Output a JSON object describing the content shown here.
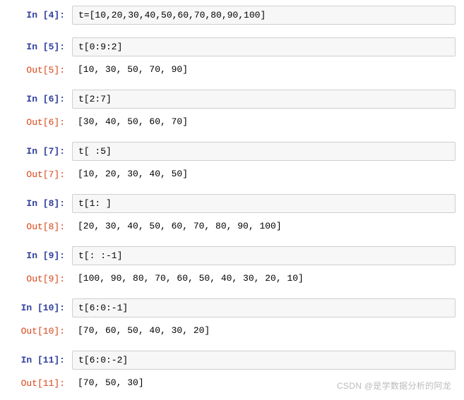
{
  "cells": [
    {
      "type": "in",
      "prompt": "In  [4]:",
      "content": "t=[10,20,30,40,50,60,70,80,90,100]"
    },
    {
      "type": "gap"
    },
    {
      "type": "in",
      "prompt": "In  [5]:",
      "content": "t[0:9:2]"
    },
    {
      "type": "out",
      "prompt": "Out[5]:",
      "content": "[10, 30, 50, 70, 90]"
    },
    {
      "type": "gap"
    },
    {
      "type": "in",
      "prompt": "In  [6]:",
      "content": "t[2:7]"
    },
    {
      "type": "out",
      "prompt": "Out[6]:",
      "content": "[30, 40, 50, 60, 70]"
    },
    {
      "type": "gap"
    },
    {
      "type": "in",
      "prompt": "In  [7]:",
      "content": "t[ :5]"
    },
    {
      "type": "out",
      "prompt": "Out[7]:",
      "content": "[10, 20, 30, 40, 50]"
    },
    {
      "type": "gap"
    },
    {
      "type": "in",
      "prompt": "In  [8]:",
      "content": "t[1: ]"
    },
    {
      "type": "out",
      "prompt": "Out[8]:",
      "content": "[20, 30, 40, 50, 60, 70, 80, 90, 100]"
    },
    {
      "type": "gap"
    },
    {
      "type": "in",
      "prompt": "In  [9]:",
      "content": "t[: :-1]"
    },
    {
      "type": "out",
      "prompt": "Out[9]:",
      "content": "[100, 90, 80, 70, 60, 50, 40, 30, 20, 10]"
    },
    {
      "type": "gap"
    },
    {
      "type": "in",
      "prompt": "In  [10]:",
      "content": "t[6:0:-1]"
    },
    {
      "type": "out",
      "prompt": "Out[10]:",
      "content": "[70, 60, 50, 40, 30, 20]"
    },
    {
      "type": "gap"
    },
    {
      "type": "in",
      "prompt": "In  [11]:",
      "content": "t[6:0:-2]"
    },
    {
      "type": "out",
      "prompt": "Out[11]:",
      "content": "[70, 50, 30]"
    }
  ],
  "watermark": "CSDN @是学数据分析的阿龙"
}
